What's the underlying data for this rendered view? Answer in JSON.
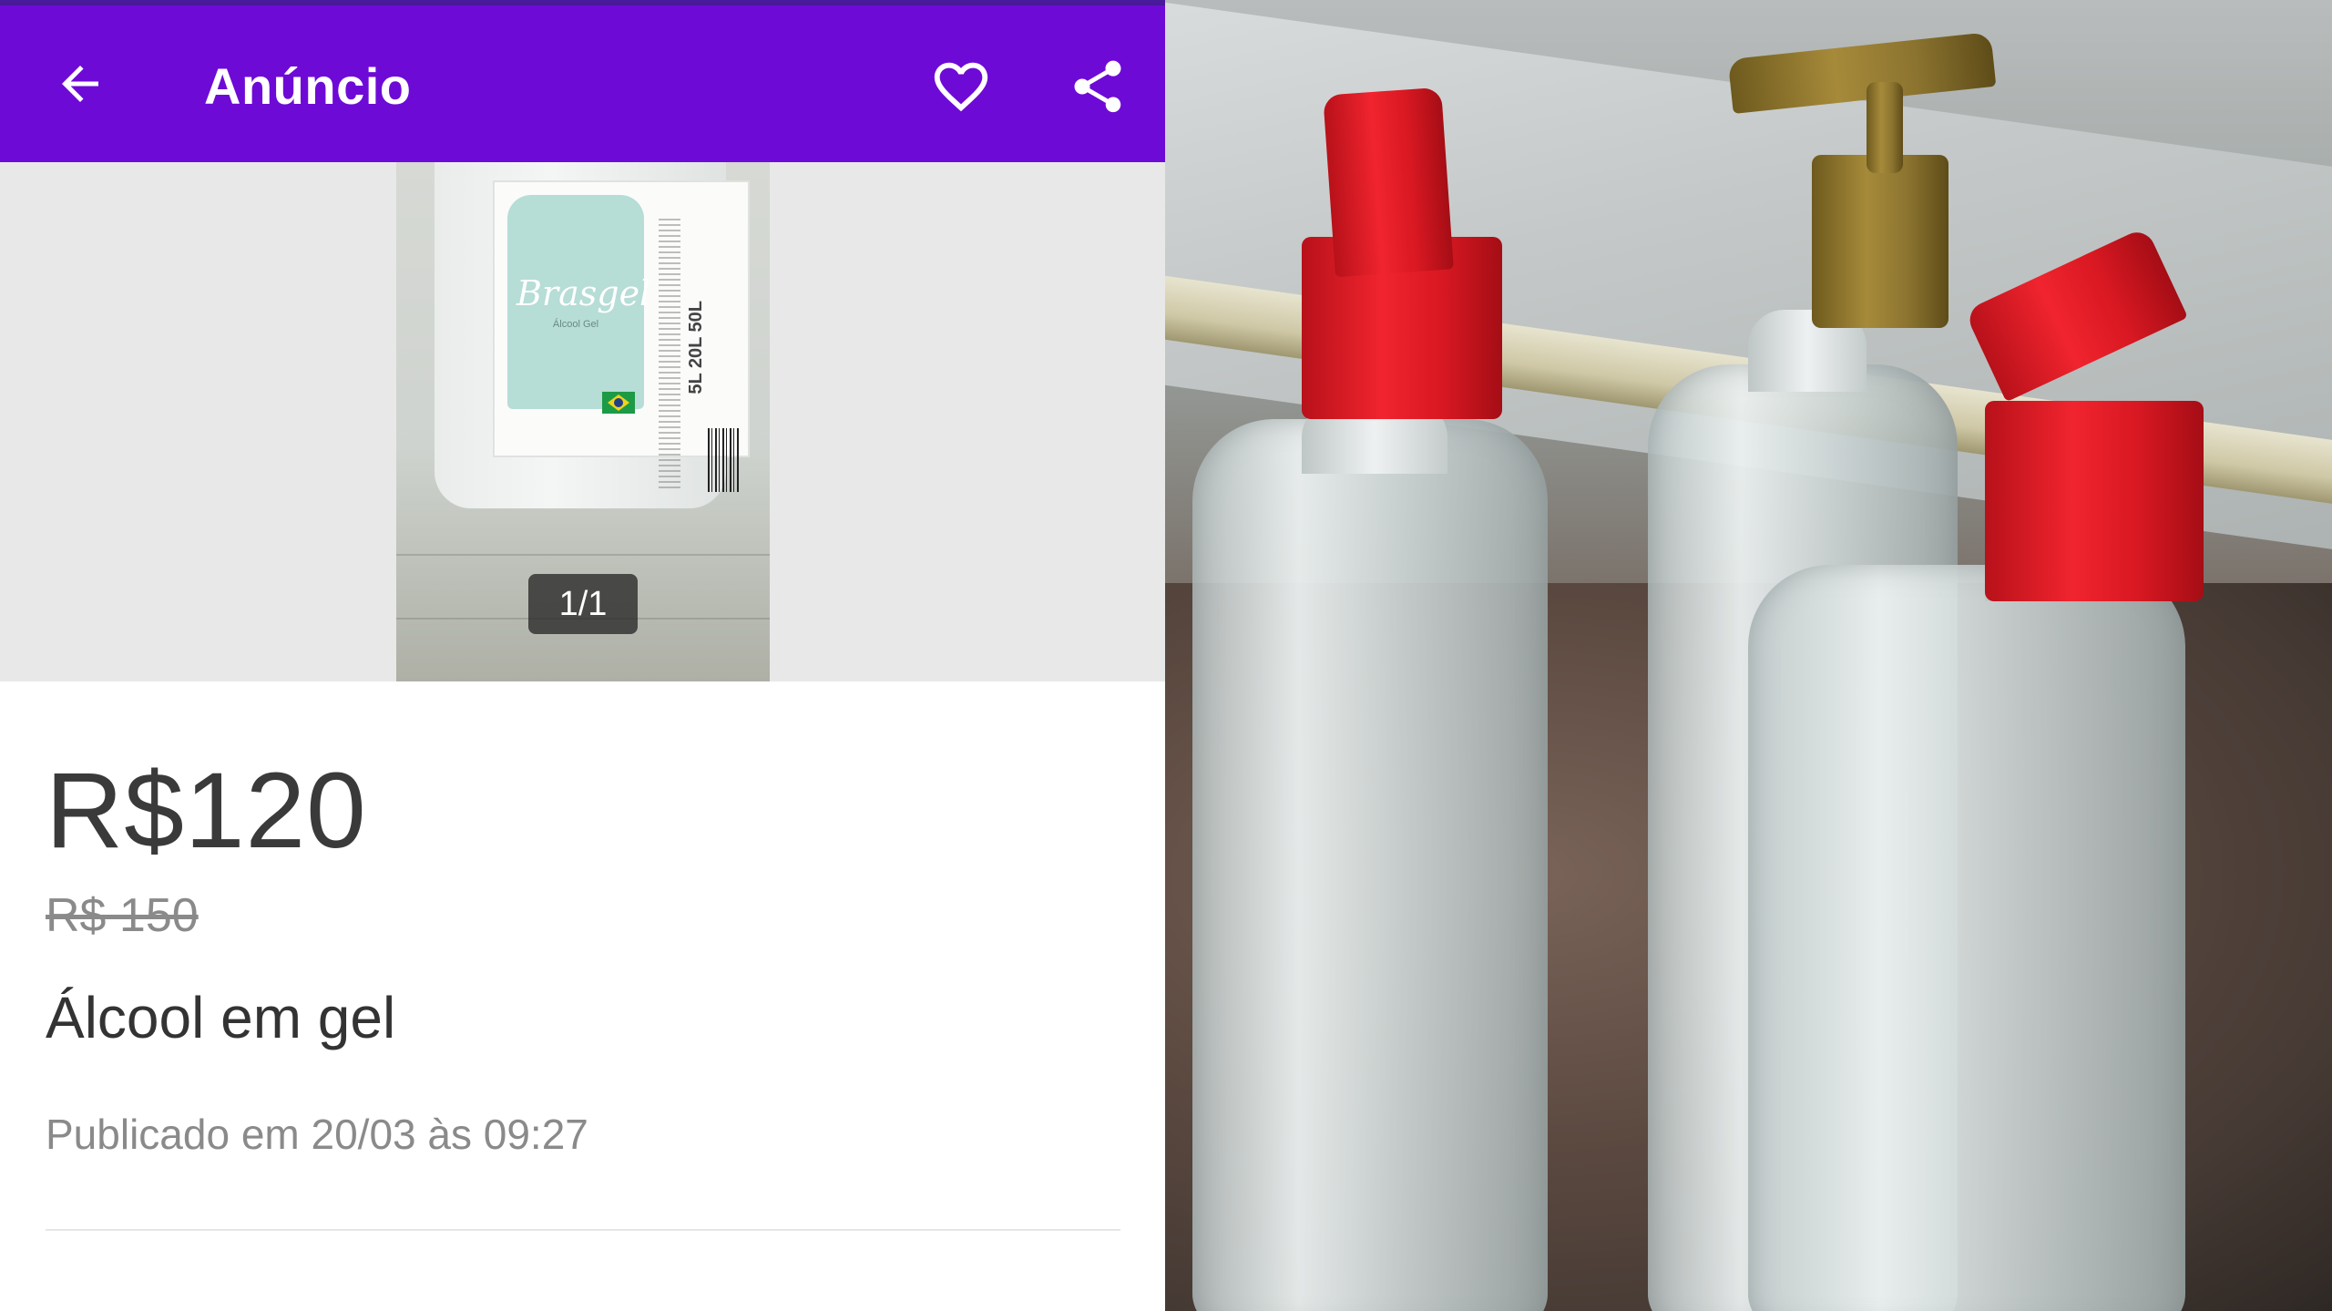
{
  "app_bar": {
    "title": "Anúncio",
    "back_icon": "arrow-left-icon",
    "favorite_icon": "heart-outline-icon",
    "share_icon": "share-icon",
    "background_color": "#6e0ad6"
  },
  "gallery": {
    "counter": "1/1",
    "product_label": {
      "brand": "Brasgel",
      "subtitle": "Álcool Gel",
      "sizes": "5L 20L 50L"
    }
  },
  "listing": {
    "price": "R$120",
    "old_price": "R$ 150",
    "title": "Álcool em gel",
    "published": "Publicado em 20/03 às 09:27"
  }
}
